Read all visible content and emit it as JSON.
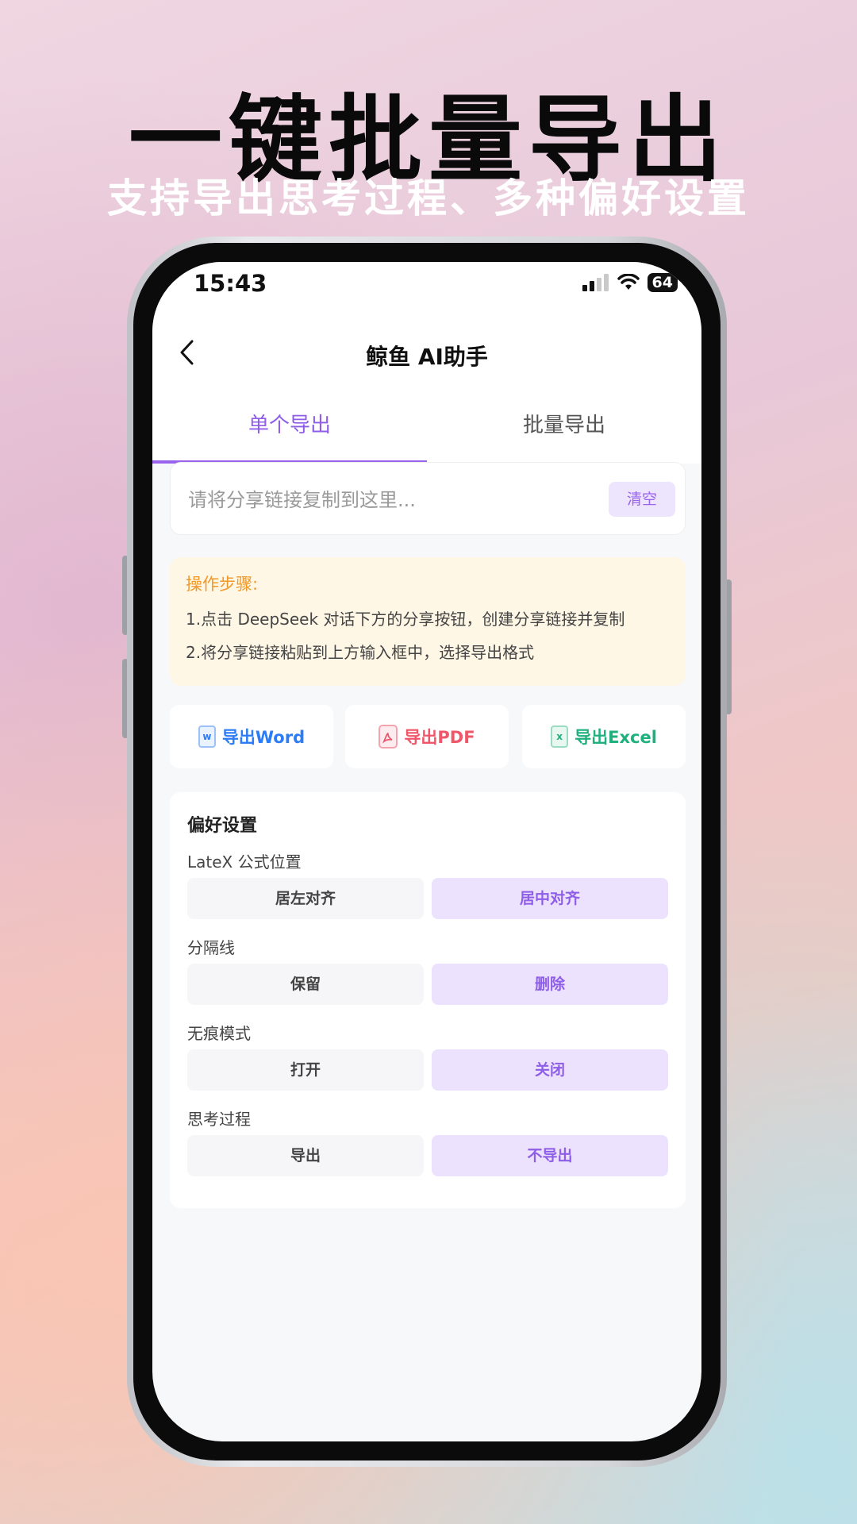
{
  "promo": {
    "headline": "一键批量导出",
    "subline": "支持导出思考过程、多种偏好设置"
  },
  "status_bar": {
    "time": "15:43",
    "battery": "64"
  },
  "nav": {
    "title": "鲸鱼 AI助手",
    "back_icon": "chevron-left-icon"
  },
  "tabs": [
    {
      "label": "单个导出",
      "active": true
    },
    {
      "label": "批量导出",
      "active": false
    }
  ],
  "link_input": {
    "placeholder": "请将分享链接复制到这里...",
    "value": "",
    "clear_label": "清空"
  },
  "steps": {
    "title": "操作步骤:",
    "items": [
      "1.点击 DeepSeek 对话下方的分享按钮，创建分享链接并复制",
      "2.将分享链接粘贴到上方输入框中，选择导出格式"
    ]
  },
  "export_buttons": [
    {
      "label": "导出Word",
      "icon": "word-file-icon",
      "icon_text": "w",
      "color": "#2b7cf6"
    },
    {
      "label": "导出PDF",
      "icon": "pdf-file-icon",
      "icon_text": "",
      "color": "#f0566a"
    },
    {
      "label": "导出Excel",
      "icon": "excel-file-icon",
      "icon_text": "x",
      "color": "#1fb07e"
    }
  ],
  "preferences": {
    "title": "偏好设置",
    "groups": [
      {
        "label": "LateX 公式位置",
        "options": [
          "居左对齐",
          "居中对齐"
        ],
        "selected": 1
      },
      {
        "label": "分隔线",
        "options": [
          "保留",
          "删除"
        ],
        "selected": 1
      },
      {
        "label": "无痕模式",
        "options": [
          "打开",
          "关闭"
        ],
        "selected": 1
      },
      {
        "label": "思考过程",
        "options": [
          "导出",
          "不导出"
        ],
        "selected": 1
      }
    ]
  },
  "colors": {
    "accent": "#9a63ee",
    "steps_title": "#f0992a",
    "steps_bg": "#fff7e6"
  }
}
